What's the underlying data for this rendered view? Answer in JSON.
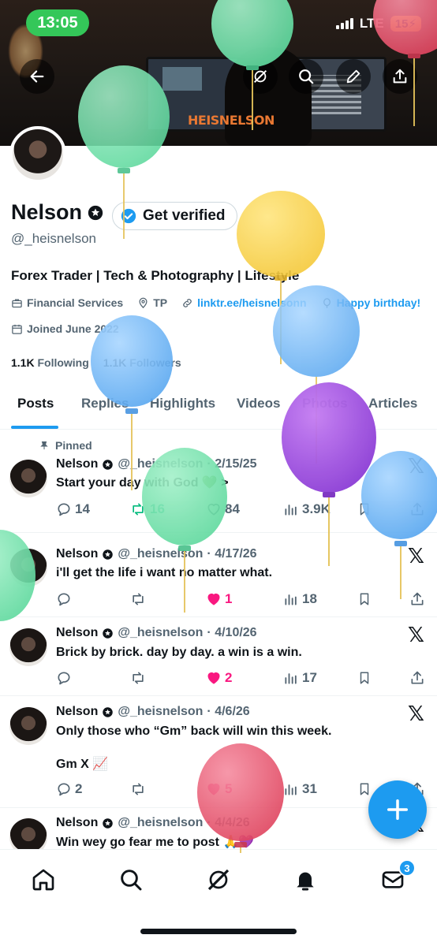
{
  "status_bar": {
    "time": "13:05",
    "network": "LTE",
    "battery": "15"
  },
  "banner": {
    "brand_text": "HEISNELSON"
  },
  "profile": {
    "name": "Nelson",
    "get_verified": "Get verified",
    "handle": "@_heisnelson",
    "bio": "Forex Trader | Tech & Photography | Lifestyle",
    "category": "Financial Services",
    "location": "TP",
    "link": "linktr.ee/heisnelsonn",
    "birthday": "Happy birthday!",
    "joined": "Joined June 2022",
    "following_count": "1.1K",
    "following_label": "Following",
    "followers_count": "1.1K",
    "followers_label": "Followers"
  },
  "tabs": [
    "Posts",
    "Replies",
    "Highlights",
    "Videos",
    "Photos",
    "Articles"
  ],
  "pinned_label": "Pinned",
  "posts": [
    {
      "name": "Nelson",
      "handle": "@_heisnelson",
      "date": "· 2/15/25",
      "text": "Start your day with God 💚 >",
      "text2": "",
      "replies": "14",
      "reposts": "16",
      "likes": "84",
      "views": "3.9K"
    },
    {
      "name": "Nelson",
      "handle": "@_heisnelson",
      "date": "· 4/17/26",
      "text": "i'll get the life i want no matter what.",
      "text2": "",
      "replies": "",
      "reposts": "",
      "likes": "1",
      "views": "18"
    },
    {
      "name": "Nelson",
      "handle": "@_heisnelson",
      "date": "· 4/10/26",
      "text": "Brick by brick. day by day. a win is a win.",
      "text2": "",
      "replies": "",
      "reposts": "",
      "likes": "2",
      "views": "17"
    },
    {
      "name": "Nelson",
      "handle": "@_heisnelson",
      "date": "· 4/6/26",
      "text": "Only those who “Gm” back will win this week.",
      "text2": "Gm X 📈",
      "replies": "2",
      "reposts": "",
      "likes": "5",
      "views": "31"
    },
    {
      "name": "Nelson",
      "handle": "@_heisnelson",
      "date": "· 4/4/26",
      "text": "Win wey go fear me to post 🙏💜",
      "text2": "",
      "replies": "",
      "reposts": "",
      "likes": "",
      "views": ""
    }
  ],
  "notification_badge": "3",
  "colors": {
    "accent": "#1d9bf0",
    "like": "#f91880",
    "repost": "#00ba7c",
    "status_green": "#34c759"
  }
}
